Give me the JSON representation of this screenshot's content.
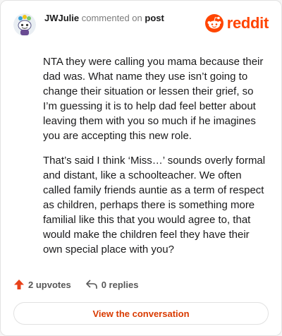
{
  "header": {
    "username": "JWJulie",
    "commented_on": "commented on",
    "post_link": "post",
    "brand": "reddit",
    "brand_color": "#ff4500",
    "avatar_icon": "snoo-avatar-icon"
  },
  "comment": {
    "paragraphs": [
      "NTA they were calling you mama because their dad was. What name they use isn’t going to change their situation or lessen their grief, so I’m guessing it is to help dad feel better about leaving them with you so much if he imagines you are accepting this new role.",
      "That’s said I think ‘Miss…’ sounds overly formal and distant, like a schoolteacher. We often called family friends auntie as a term of respect as children, perhaps there is something more familial like this that you would agree to, that would make the children feel they have their own special place with you?"
    ]
  },
  "actions": {
    "upvotes": "2 upvotes",
    "replies": "0 replies",
    "upvote_icon": "upvote-arrow-icon",
    "reply_icon": "reply-arrow-icon"
  },
  "cta": {
    "label": "View the conversation",
    "color": "#d93a00"
  }
}
